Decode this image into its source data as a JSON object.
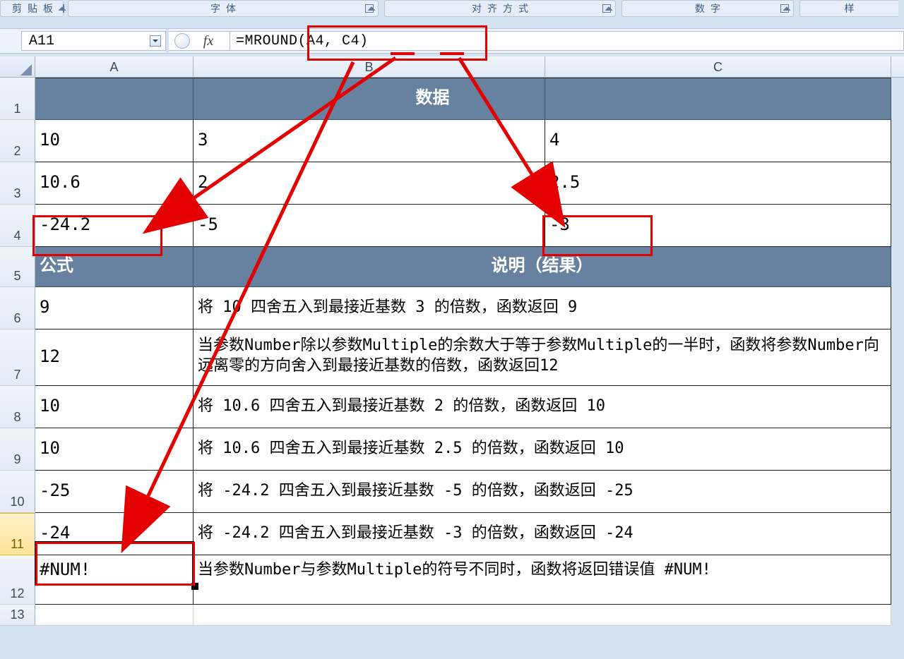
{
  "ribbon": {
    "g1": "剪贴板",
    "g2": "字体",
    "g3": "对齐方式",
    "g4": "数字",
    "g5": "样"
  },
  "nameBox": "A11",
  "fxLabel": "fx",
  "formula": "=MROUND(A4, C4)",
  "cols": {
    "A": "A",
    "B": "B",
    "C": "C"
  },
  "rows": [
    "1",
    "2",
    "3",
    "4",
    "5",
    "6",
    "7",
    "8",
    "9",
    "10",
    "11",
    "12",
    "13"
  ],
  "cells": {
    "r1_merged": "数据",
    "r2": {
      "A": "10",
      "B": "3",
      "C": "4"
    },
    "r3": {
      "A": "10.6",
      "B": "2",
      "C": "2.5"
    },
    "r4": {
      "A": "-24.2",
      "B": "-5",
      "C": "-3"
    },
    "r5": {
      "A": "公式",
      "BC": "说明（结果）"
    },
    "r6": {
      "A": "9",
      "BC": "将 10 四舍五入到最接近基数 3 的倍数，函数返回 9"
    },
    "r7": {
      "A": "12",
      "BC": "当参数Number除以参数Multiple的余数大于等于参数Multiple的一半时，函数将参数Number向远离零的方向舍入到最接近基数的倍数，函数返回12"
    },
    "r8": {
      "A": "10",
      "BC": "将 10.6 四舍五入到最接近基数 2 的倍数，函数返回 10"
    },
    "r9": {
      "A": "10",
      "BC": "将 10.6 四舍五入到最接近基数 2.5 的倍数，函数返回 10"
    },
    "r10": {
      "A": "-25",
      "BC": "将 -24.2 四舍五入到最接近基数 -5 的倍数，函数返回 -25"
    },
    "r11": {
      "A": "-24",
      "BC": "将 -24.2 四舍五入到最接近基数 -3 的倍数，函数返回 -24"
    },
    "r12": {
      "A": "#NUM!",
      "BC": "当参数Number与参数Multiple的符号不同时，函数将返回错误值 #NUM!"
    }
  },
  "annotations": {
    "formulaRect": "highlight around formula bar content",
    "a4Rect": "highlight around cell A4",
    "c4Rect": "highlight around cell C4",
    "a11Rect": "highlight around cell A11",
    "underA4": "underline under 'A4' in formula",
    "underC4": "underline under 'C4' in formula",
    "arrows": [
      "formula→A4",
      "formula→C4",
      "formula→A11"
    ]
  }
}
